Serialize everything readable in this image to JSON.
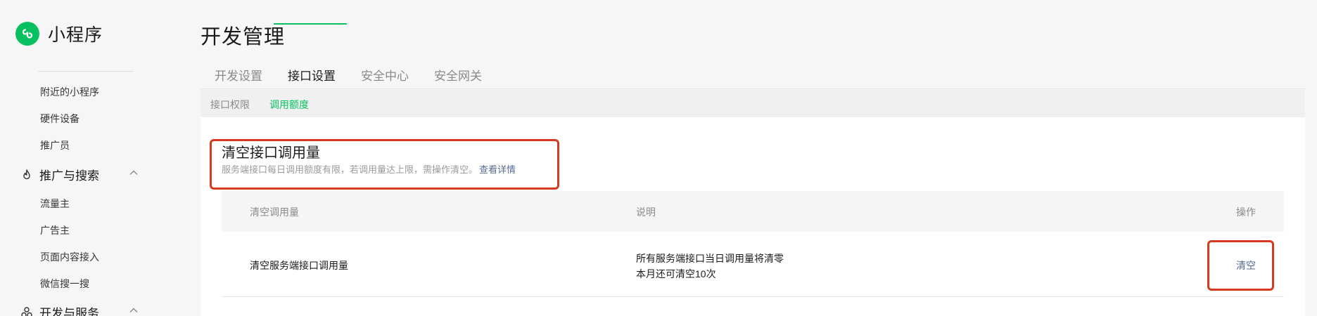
{
  "brand": {
    "name": "小程序",
    "color": "#07c160"
  },
  "sidebar": {
    "items_top": [
      {
        "label": "附近的小程序"
      },
      {
        "label": "硬件设备"
      },
      {
        "label": "推广员"
      }
    ],
    "group_promo": {
      "label": "推广与搜索",
      "icon": "flame-icon",
      "expanded": true
    },
    "items_promo": [
      {
        "label": "流量主"
      },
      {
        "label": "广告主"
      },
      {
        "label": "页面内容接入"
      },
      {
        "label": "微信搜一搜"
      }
    ],
    "group_dev": {
      "label": "开发与服务",
      "icon": "cluster-icon",
      "expanded": true
    }
  },
  "main": {
    "title": "开发管理",
    "tabs": [
      {
        "label": "开发设置",
        "active": false
      },
      {
        "label": "接口设置",
        "active": true
      },
      {
        "label": "安全中心",
        "active": false
      },
      {
        "label": "安全网关",
        "active": false
      }
    ],
    "subtabs": [
      {
        "label": "接口权限",
        "active": false
      },
      {
        "label": "调用额度",
        "active": true
      }
    ],
    "section": {
      "title": "清空接口调用量",
      "desc": "服务端接口每日调用额度有限，若调用量达上限，需操作清空。",
      "link": "查看详情"
    },
    "table": {
      "headers": [
        "清空调用量",
        "说明",
        "操作"
      ],
      "rows": [
        {
          "name": "清空服务端接口调用量",
          "desc_line1": "所有服务端接口当日调用量将清零",
          "desc_line2": "本月还可清空10次",
          "action": "清空"
        }
      ]
    }
  },
  "colors": {
    "accent": "#07c160",
    "link": "#576b95",
    "highlight": "#d6391e"
  }
}
